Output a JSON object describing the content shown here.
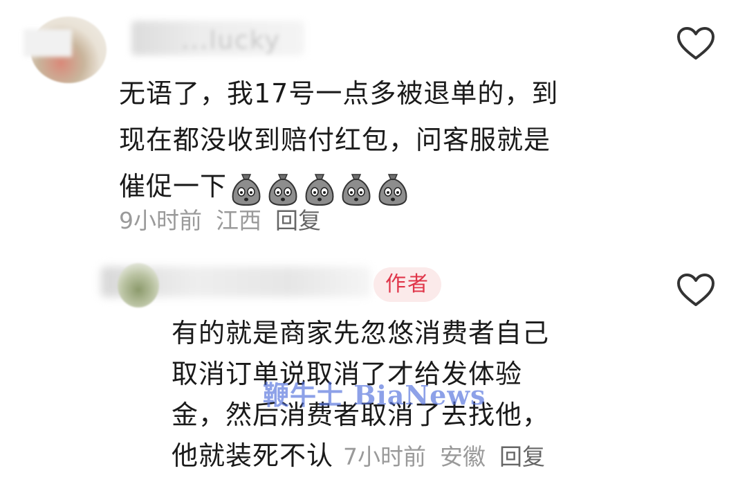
{
  "comments": [
    {
      "username": "...lucky",
      "text_lines": [
        "无语了，我17号一点多被退单的，到",
        "现在都没收到赔付红包，问客服就是",
        "催促一下"
      ],
      "emojis": [
        "shocked-bag-emoji",
        "shocked-bag-emoji",
        "shocked-bag-emoji",
        "shocked-bag-emoji",
        "shocked-bag-emoji"
      ],
      "time": "9小时前",
      "location": "江西",
      "reply_label": "回复",
      "liked": false
    },
    {
      "badge": "作者",
      "text_lines": [
        "有的就是商家先忽悠消费者自己",
        "取消订单说取消了才给发体验",
        "金，然后消费者取消了去找他，",
        "他就装死不认"
      ],
      "time": "7小时前",
      "location": "安徽",
      "reply_label": "回复",
      "liked": false
    }
  ],
  "watermark": "鞭牛士 BiaNews",
  "colors": {
    "badge_text": "#e0364a",
    "badge_bg": "#fbeaea",
    "meta_text": "#9a9a9a",
    "watermark": "#506edc"
  }
}
